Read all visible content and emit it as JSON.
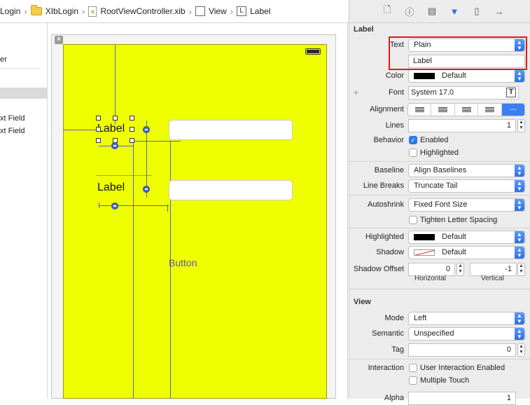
{
  "breadcrumb": {
    "items": [
      "Login",
      "XIbLogin",
      "RootViewController.xib",
      "View",
      "Label"
    ]
  },
  "outline": {
    "items": [
      "er",
      "xt Field",
      "xt Field"
    ]
  },
  "canvas": {
    "label1": "Label",
    "label2": "Label",
    "button": "Button",
    "close": "×"
  },
  "inspector": {
    "tabs": [
      "file",
      "help",
      "identity",
      "attributes",
      "size",
      "connections"
    ],
    "label_section": {
      "title": "Label",
      "text_label": "Text",
      "text_type": "Plain",
      "text_value": "Label",
      "color_label": "Color",
      "color_value": "Default",
      "font_label": "Font",
      "font_value": "System 17.0",
      "alignment_label": "Alignment",
      "alignment_more": "---",
      "lines_label": "Lines",
      "lines_value": "1",
      "behavior_label": "Behavior",
      "enabled_label": "Enabled",
      "highlighted_check_label": "Highlighted",
      "baseline_label": "Baseline",
      "baseline_value": "Align Baselines",
      "linebreaks_label": "Line Breaks",
      "linebreaks_value": "Truncate Tail",
      "autoshrink_label": "Autoshrink",
      "autoshrink_value": "Fixed Font Size",
      "tighten_label": "Tighten Letter Spacing",
      "highlighted_label": "Highlighted",
      "highlighted_value": "Default",
      "shadow_label": "Shadow",
      "shadow_value": "Default",
      "shadow_offset_label": "Shadow Offset",
      "shadow_offset_h": "0",
      "shadow_offset_v": "-1",
      "horizontal": "Horizontal",
      "vertical": "Vertical",
      "plus": "+"
    },
    "view_section": {
      "title": "View",
      "mode_label": "Mode",
      "mode_value": "Left",
      "semantic_label": "Semantic",
      "semantic_value": "Unspecified",
      "tag_label": "Tag",
      "tag_value": "0",
      "interaction_label": "Interaction",
      "user_interaction": "User Interaction Enabled",
      "multiple_touch": "Multiple Touch",
      "alpha_label": "Alpha",
      "alpha_value": "1"
    }
  },
  "colors": {
    "device_background": "#f0ff00",
    "constraint": "#4a67c9",
    "highlight_box": "#e01a1a",
    "accent": "#2f6fe0"
  }
}
